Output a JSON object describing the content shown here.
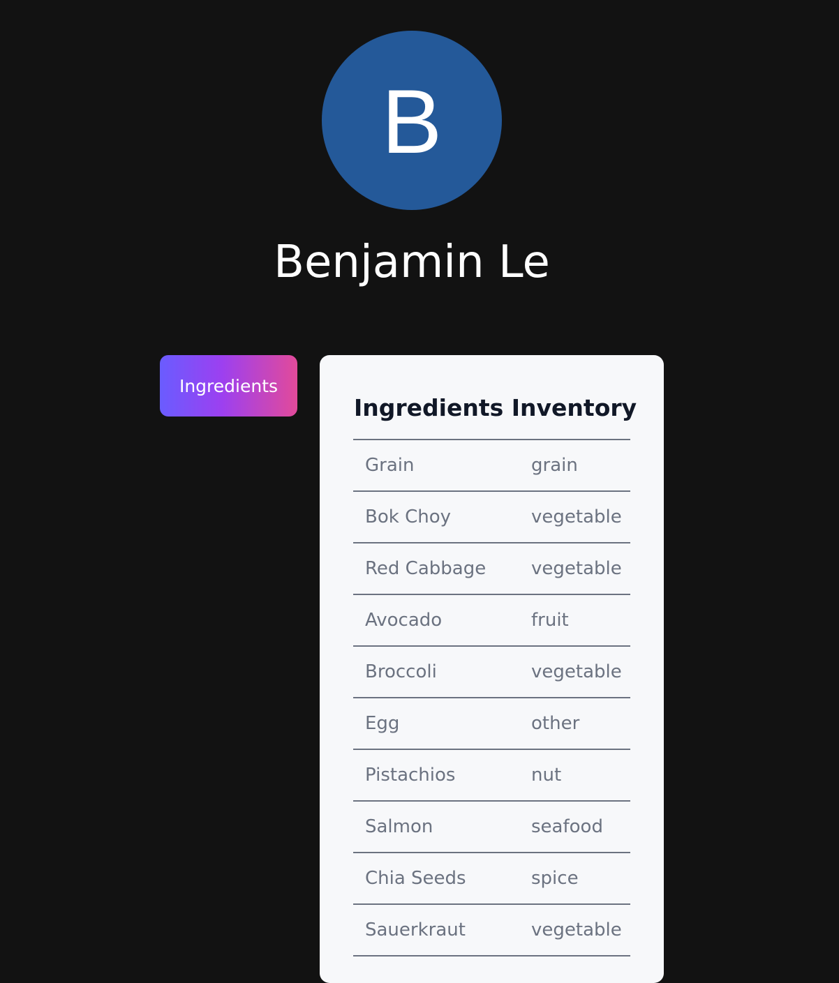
{
  "profile": {
    "avatar_letter": "B",
    "avatar_color": "#245999",
    "name": "Benjamin Le"
  },
  "nav": {
    "ingredients_label": "Ingredients"
  },
  "inventory": {
    "title": "Ingredients Inventory",
    "rows": [
      {
        "name": "Grain",
        "type": "grain"
      },
      {
        "name": "Bok Choy",
        "type": "vegetable"
      },
      {
        "name": "Red Cabbage",
        "type": "vegetable"
      },
      {
        "name": "Avocado",
        "type": "fruit"
      },
      {
        "name": "Broccoli",
        "type": "vegetable"
      },
      {
        "name": "Egg",
        "type": "other"
      },
      {
        "name": "Pistachios",
        "type": "nut"
      },
      {
        "name": "Salmon",
        "type": "seafood"
      },
      {
        "name": "Chia Seeds",
        "type": "spice"
      },
      {
        "name": "Sauerkraut",
        "type": "vegetable"
      }
    ]
  },
  "colors": {
    "background": "#121212",
    "card": "#f7f8fa",
    "button_gradient": [
      "#6a5cff",
      "#9c40f0",
      "#e24a9a"
    ]
  }
}
